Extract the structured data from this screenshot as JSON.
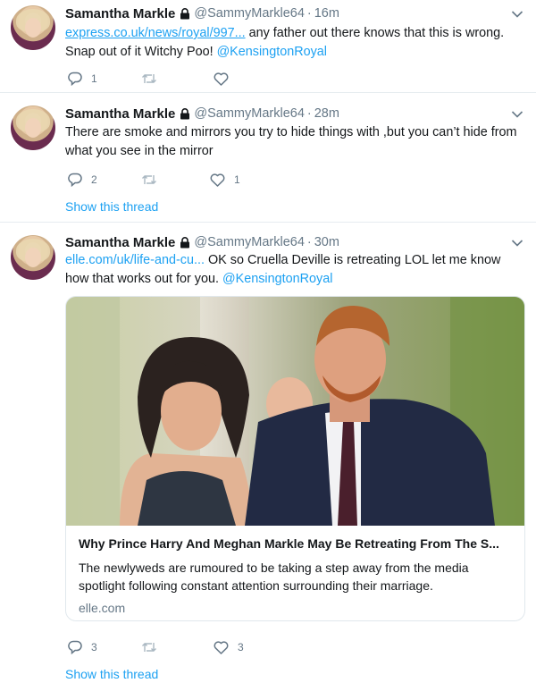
{
  "colors": {
    "accent": "#1da1f2",
    "muted": "#657786",
    "border": "#e6ecf0"
  },
  "tweets": [
    {
      "name": "Samantha Markle",
      "handle": "@SammyMarkle64",
      "time": "16m",
      "link": "express.co.uk/news/royal/997...",
      "text_after_link": " any father out there knows that this is wrong.",
      "line2": "Snap out of it Witchy Poo! ",
      "mention": "@KensingtonRoyal",
      "replies": "1",
      "retweets": "",
      "likes": ""
    },
    {
      "name": "Samantha Markle",
      "handle": "@SammyMarkle64",
      "time": "28m",
      "text": "There are smoke and mirrors you try to hide things with ,but you can’t hide from what you see in the mirror",
      "replies": "2",
      "retweets": "",
      "likes": "1",
      "show_thread": "Show this thread"
    },
    {
      "name": "Samantha Markle",
      "handle": "@SammyMarkle64",
      "time": "30m",
      "link": "elle.com/uk/life-and-cu...",
      "text_after_link": "  OK so Cruella Deville is retreating LOL  let me know",
      "line2": "how that works out for you. ",
      "mention": "@KensingtonRoyal",
      "card": {
        "title": "Why Prince Harry And Meghan Markle May Be Retreating From The S...",
        "description": "The newlyweds are rumoured to be taking a step away from the media spotlight following constant attention surrounding their marriage.",
        "domain": "elle.com"
      },
      "replies": "3",
      "retweets": "",
      "likes": "3",
      "show_thread": "Show this thread"
    }
  ]
}
